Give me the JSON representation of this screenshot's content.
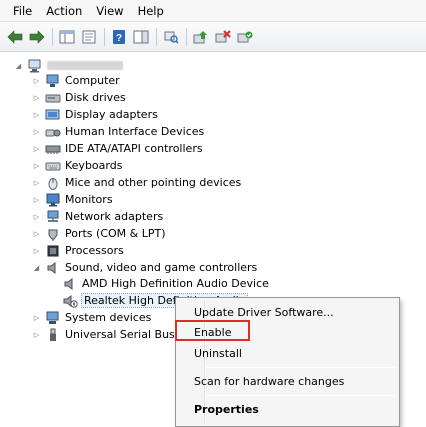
{
  "menubar": {
    "items": [
      "File",
      "Action",
      "View",
      "Help"
    ]
  },
  "toolbar": {
    "icons": [
      "back-arrow-icon",
      "forward-arrow-icon",
      "show-hide-tree-icon",
      "properties-icon",
      "help-icon",
      "action-pane-icon",
      "scan-hardware-icon",
      "update-driver-icon",
      "uninstall-device-icon",
      "enable-device-icon"
    ]
  },
  "tree": {
    "categories": [
      {
        "label": "Computer",
        "icon": "computer-icon"
      },
      {
        "label": "Disk drives",
        "icon": "disk-drive-icon"
      },
      {
        "label": "Display adapters",
        "icon": "display-adapter-icon"
      },
      {
        "label": "Human Interface Devices",
        "icon": "hid-icon"
      },
      {
        "label": "IDE ATA/ATAPI controllers",
        "icon": "ide-controller-icon"
      },
      {
        "label": "Keyboards",
        "icon": "keyboard-icon"
      },
      {
        "label": "Mice and other pointing devices",
        "icon": "mouse-icon"
      },
      {
        "label": "Monitors",
        "icon": "monitor-icon"
      },
      {
        "label": "Network adapters",
        "icon": "network-adapter-icon"
      },
      {
        "label": "Ports (COM & LPT)",
        "icon": "port-icon"
      },
      {
        "label": "Processors",
        "icon": "processor-icon"
      },
      {
        "label": "Sound, video and game controllers",
        "icon": "speaker-icon"
      }
    ],
    "sound_children": [
      {
        "label": "AMD High Definition Audio Device",
        "icon": "speaker-icon"
      },
      {
        "label": "Realtek High Definition Audio",
        "icon": "disabled-speaker-icon"
      }
    ],
    "after": [
      {
        "label": "System devices",
        "icon": "system-device-icon"
      },
      {
        "label": "Universal Serial Bus",
        "icon": "usb-icon"
      }
    ]
  },
  "context_menu": {
    "update_driver": "Update Driver Software...",
    "enable": "Enable",
    "uninstall": "Uninstall",
    "scan": "Scan for hardware changes",
    "properties": "Properties"
  }
}
